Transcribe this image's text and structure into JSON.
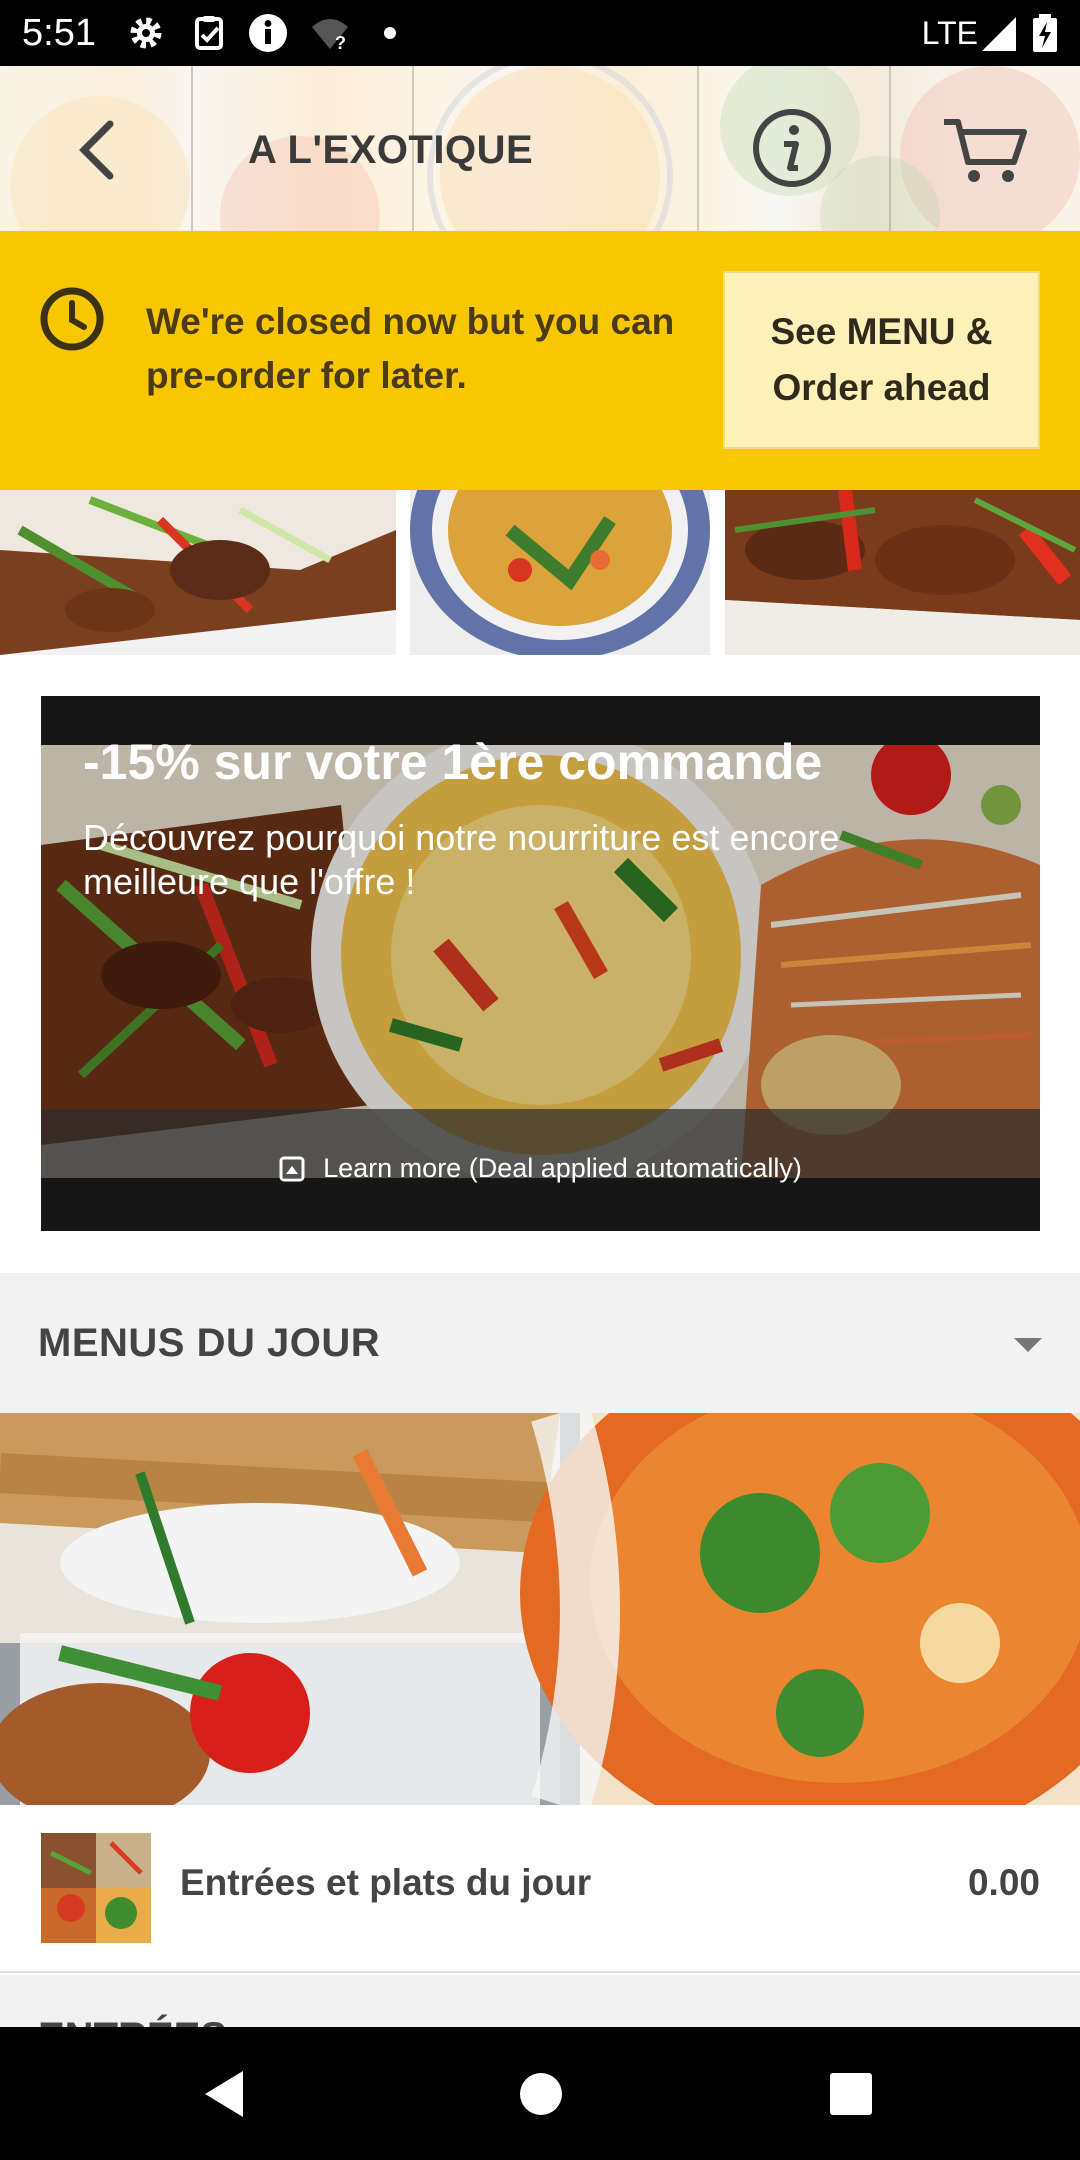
{
  "status_bar": {
    "time": "5:51",
    "network": "LTE",
    "icons": [
      "settings-icon",
      "clipboard-check-icon",
      "info-icon",
      "wifi-unknown-icon",
      "dot-icon",
      "signal-icon",
      "battery-charging-icon"
    ]
  },
  "header": {
    "title": "A L'EXOTIQUE",
    "icons": [
      "back-arrow-icon",
      "info-circle-icon",
      "cart-icon"
    ]
  },
  "closed_banner": {
    "message": "We're closed now but you can pre-order for later.",
    "button_label": "See MENU & Order ahead",
    "icon": "clock-icon",
    "color": "#f8c700"
  },
  "deal": {
    "title": "-15% sur votre 1ère commande",
    "subtitle": "Découvrez pourquoi notre nourriture est encore meilleure que l'offre !",
    "learn_more": "Learn more (Deal applied automatically)",
    "icon": "expand-box-icon"
  },
  "sections": [
    {
      "title": "MENUS DU JOUR",
      "toggle_icon": "caret-down-icon",
      "items": [
        {
          "name": "Entrées et plats du jour",
          "price": "0.00"
        }
      ]
    },
    {
      "title": "ENTRÉES"
    }
  ],
  "nav_bar": {
    "icons": [
      "back-triangle-icon",
      "home-circle-icon",
      "recents-square-icon"
    ]
  }
}
